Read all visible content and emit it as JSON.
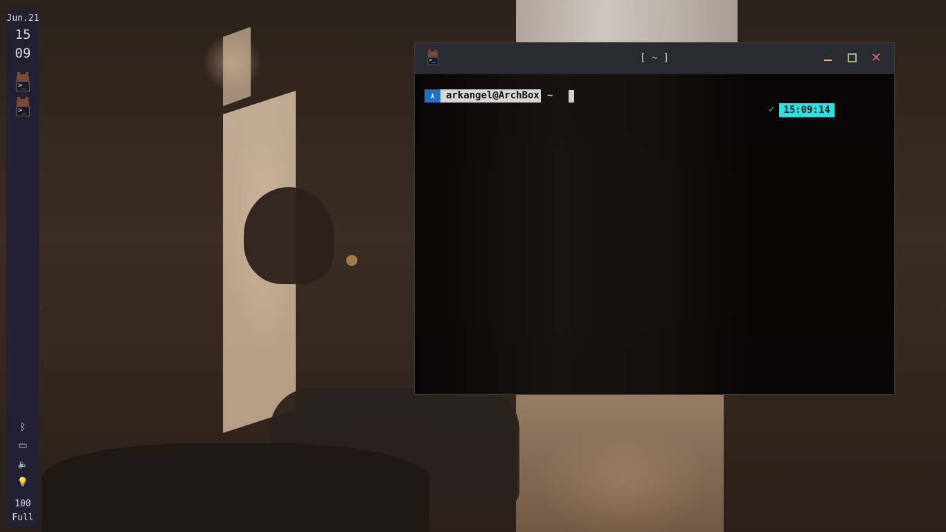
{
  "sidebar": {
    "date": "Jun.21",
    "hour": "15",
    "minute": "09",
    "apps": [
      {
        "name": "terminal-icon",
        "glyph": ">_"
      },
      {
        "name": "terminal-icon",
        "glyph": ">_"
      }
    ],
    "tray": {
      "bluetooth_icon": "ᛒ",
      "display_icon": "▭",
      "volume_icon": "🔈",
      "brightness_icon": "💡",
      "battery_level": "100",
      "battery_status": "Full"
    }
  },
  "terminal": {
    "title": "[ ~ ]",
    "close_glyph": "✕",
    "prompt": {
      "os_glyph": "⋏",
      "user_host": "arkangel@ArchBox",
      "directory": "~"
    },
    "status_glyph": "✓",
    "time": "15:09:14",
    "icon_glyph": ">_"
  },
  "colors": {
    "sidebar_bg": "#232034",
    "titlebar_bg": "#2a2b33",
    "prompt_os_bg": "#1e6fc9",
    "prompt_user_bg": "#d6d6d6",
    "time_bg": "#22e5e5",
    "ok_green": "#3fd13f",
    "minimize": "#e5c07b",
    "maximize": "#98c379",
    "close": "#e06c75"
  }
}
